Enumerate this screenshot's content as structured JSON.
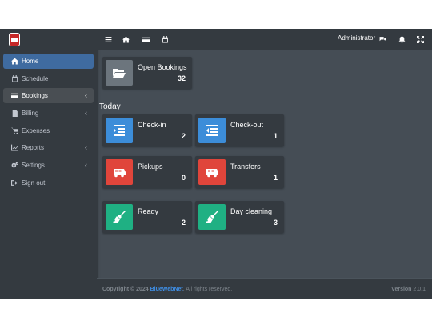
{
  "sidebar": {
    "items": [
      {
        "label": "Home",
        "icon": "home-icon"
      },
      {
        "label": "Schedule",
        "icon": "calendar-icon"
      },
      {
        "label": "Bookings",
        "icon": "credit-card-icon"
      },
      {
        "label": "Billing",
        "icon": "file-icon"
      },
      {
        "label": "Expenses",
        "icon": "cart-icon"
      },
      {
        "label": "Reports",
        "icon": "chart-icon"
      },
      {
        "label": "Settings",
        "icon": "cogs-icon"
      },
      {
        "label": "Sign out",
        "icon": "sign-out-icon"
      }
    ]
  },
  "topbar": {
    "user": "Administrator"
  },
  "open_bookings": {
    "label": "Open Bookings",
    "value": "32"
  },
  "today_heading": "Today",
  "cards": {
    "checkin": {
      "label": "Check-in",
      "value": "2"
    },
    "checkout": {
      "label": "Check-out",
      "value": "1"
    },
    "pickups": {
      "label": "Pickups",
      "value": "0"
    },
    "transfers": {
      "label": "Transfers",
      "value": "1"
    },
    "ready": {
      "label": "Ready",
      "value": "2"
    },
    "day_cleaning": {
      "label": "Day cleaning",
      "value": "3"
    }
  },
  "footer": {
    "copyright": "Copyright © 2024",
    "brand": "BlueWebNet",
    "rights": ". All rights reserved.",
    "version_label": "Version",
    "version": "2.0.1"
  },
  "colors": {
    "blue": "#3c8dd9",
    "red": "#e0453b",
    "green": "#1fb083",
    "gray": "#6c757d"
  }
}
